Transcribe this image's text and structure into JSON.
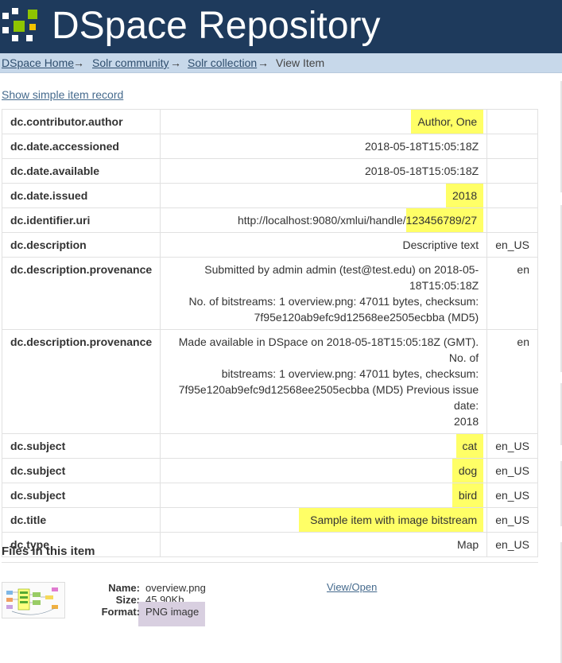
{
  "header": {
    "title": "DSpace Repository",
    "colors": {
      "background": "#1e3a5c",
      "logo_white": "#ffffff",
      "logo_green": "#8fc400",
      "logo_yellow": "#f2c300"
    }
  },
  "breadcrumb": {
    "items": [
      "DSpace Home",
      "Solr community",
      "Solr collection",
      "View Item"
    ],
    "separator": "→"
  },
  "show_simple_record": "Show simple item record",
  "metadata": [
    {
      "field": "dc.contributor.author",
      "value": "Author, One",
      "lang": "",
      "highlighted": true
    },
    {
      "field": "dc.date.accessioned",
      "value": "2018-05-18T15:05:18Z",
      "lang": "",
      "highlighted": false
    },
    {
      "field": "dc.date.available",
      "value": "2018-05-18T15:05:18Z",
      "lang": "",
      "highlighted": false
    },
    {
      "field": "dc.date.issued",
      "value": "2018",
      "lang": "",
      "highlighted": true
    },
    {
      "field": "dc.identifier.uri",
      "value_prefix": "http://localhost:9080/xmlui/handle/",
      "value_handle": "123456789/27",
      "lang": "",
      "highlighted": true
    },
    {
      "field": "dc.description",
      "value": "Descriptive text",
      "lang": "en_US",
      "highlighted": false
    },
    {
      "field": "dc.description.provenance",
      "value_lines": [
        "Submitted by admin admin (test@test.edu) on 2018-05-18T15:05:18Z",
        "No. of bitstreams: 1 overview.png: 47011 bytes, checksum:",
        "7f95e120ab9efc9d12568ee2505ecbba (MD5)"
      ],
      "lang": "en",
      "highlighted": false
    },
    {
      "field": "dc.description.provenance",
      "value_lines": [
        "Made available in DSpace on 2018-05-18T15:05:18Z (GMT). No. of",
        "bitstreams: 1 overview.png: 47011 bytes, checksum:",
        "7f95e120ab9efc9d12568ee2505ecbba (MD5) Previous issue date:",
        "2018"
      ],
      "lang": "en",
      "highlighted": false
    },
    {
      "field": "dc.subject",
      "value": "cat",
      "lang": "en_US",
      "highlighted": true
    },
    {
      "field": "dc.subject",
      "value": "dog",
      "lang": "en_US",
      "highlighted": true
    },
    {
      "field": "dc.subject",
      "value": "bird",
      "lang": "en_US",
      "highlighted": true
    },
    {
      "field": "dc.title",
      "value": "Sample item with image bitstream",
      "lang": "en_US",
      "highlighted": true
    },
    {
      "field": "dc.type",
      "value": "Map",
      "lang": "en_US",
      "highlighted": false
    }
  ],
  "files": {
    "heading": "Files in this item",
    "name_label": "Name:",
    "name": "overview.png",
    "size_label": "Size:",
    "size": "45.90Kb",
    "format_label": "Format:",
    "format": "PNG image",
    "view_open": "View/Open"
  },
  "highlight_colors": {
    "yellow": "#ffff66",
    "lavender": "#d8cfe0"
  }
}
